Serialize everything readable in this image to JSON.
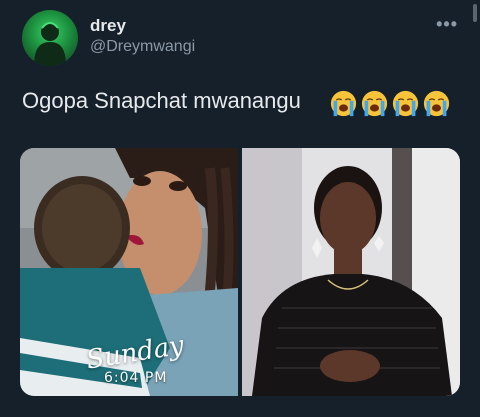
{
  "tweet": {
    "display_name": "drey",
    "handle": "@Dreymwangi",
    "more_icon": "more-horizontal-icon",
    "text": "Ogopa Snapchat mwanangu",
    "emoji_count_label": "loudly-crying-face"
  },
  "media": {
    "left_photo_overlay_day": "Sunday",
    "left_photo_overlay_time": "6:04 PM"
  },
  "colors": {
    "background": "#15202b",
    "primary_text": "#e7e9ea",
    "secondary_text": "#8b98a5"
  }
}
